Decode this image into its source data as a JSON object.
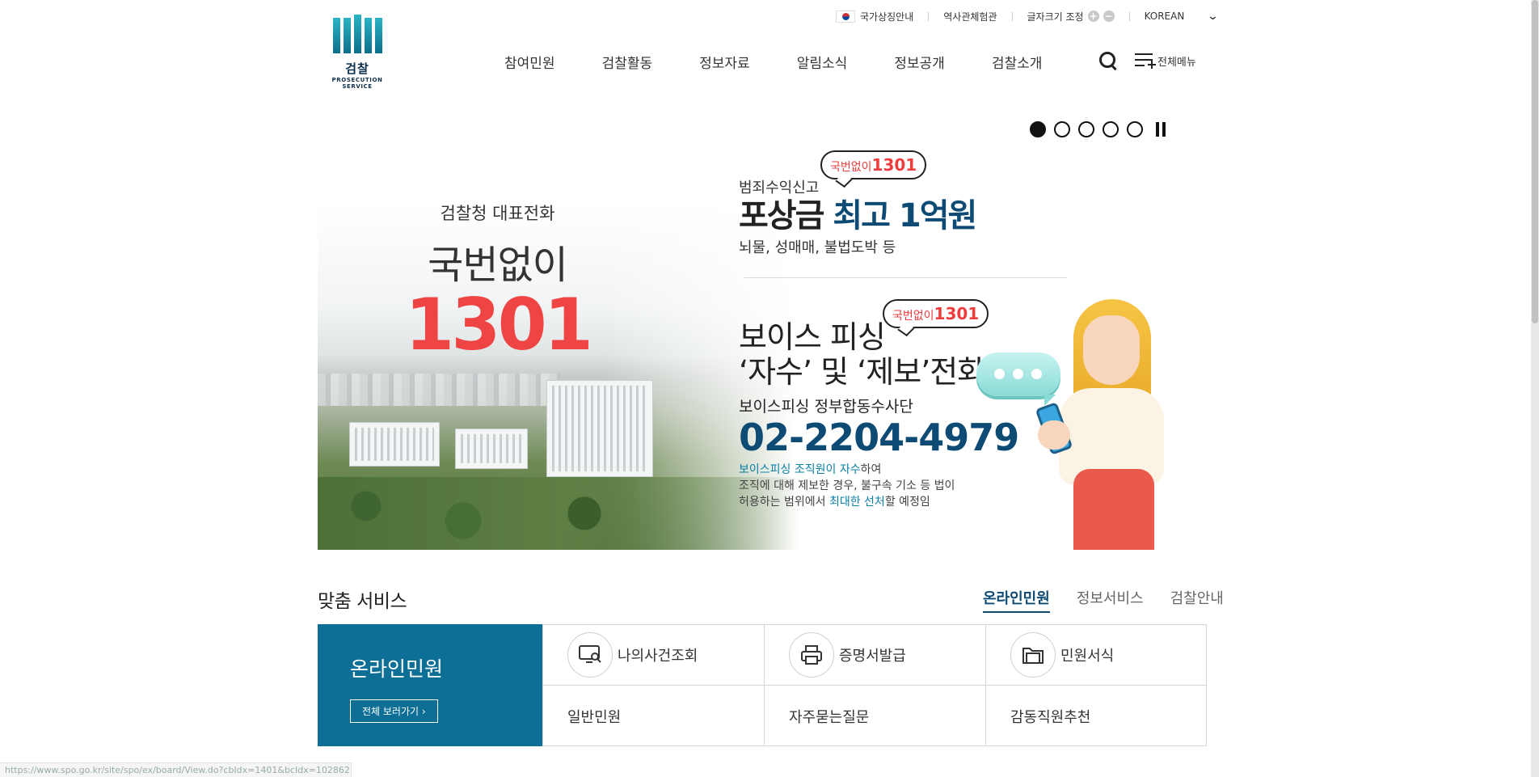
{
  "logo": {
    "korean": "검찰",
    "english": "PROSECUTION SERVICE"
  },
  "util": {
    "symbol_label": "국가상징안내",
    "history_label": "역사관체험관",
    "font_size_label": "글자크기 조정",
    "font_plus": "+",
    "font_minus": "−",
    "language": "KOREAN"
  },
  "gnb": [
    "참여민원",
    "검찰활동",
    "정보자료",
    "알림소식",
    "정보공개",
    "검찰소개"
  ],
  "all_menu_label": "전체메뉴",
  "banner": {
    "left": {
      "line1": "검찰청 대표전화",
      "line2": "국번없이",
      "number": "1301"
    },
    "reward": {
      "bubble_prefix": "국번없이",
      "bubble_num": "1301",
      "label": "범죄수익신고",
      "headline_a": "포상금",
      "headline_b": "최고 1억원",
      "sub": "뇌물, 성매매, 불법도박 등"
    },
    "phishing": {
      "bubble_prefix": "국번없이",
      "bubble_num": "1301",
      "title1": "보이스 피싱",
      "title2": "‘자수’ 및 ‘제보’전화",
      "team": "보이스피싱 정부합동수사단",
      "phone": "02-2204-4979",
      "desc_hl": "보이스피싱 조직원이 자수",
      "desc_a": "하여",
      "desc_line2": "조직에 대해 제보한 경우, 불구속 기소 등 법이",
      "desc_line3_a": "허용하는 범위에서 ",
      "desc_line3_hl": "최대한 선처",
      "desc_line3_b": "할 예정임"
    },
    "slides_total": 5,
    "slide_active": 1
  },
  "services": {
    "title": "맞춤 서비스",
    "tabs": [
      "온라인민원",
      "정보서비스",
      "검찰안내"
    ],
    "active_tab": "온라인민원",
    "feature_title": "온라인민원",
    "view_all": "전체 보러가기",
    "items": [
      "나의사건조회",
      "증명서발급",
      "민원서식",
      "일반민원",
      "자주묻는질문",
      "감동직원추천"
    ]
  },
  "status_url": "https://www.spo.go.kr/site/spo/ex/board/View.do?cbIdx=1401&bcIdx=1028621",
  "colors": {
    "brand": "#0e6f96",
    "navy": "#0e4b74",
    "accent_red": "#ef4444"
  }
}
